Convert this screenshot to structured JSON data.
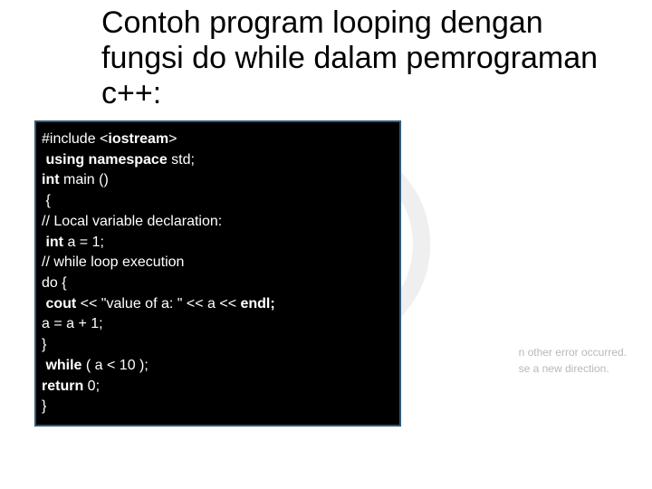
{
  "title": "Contoh program looping dengan fungsi do while dalam pemrograman c++:",
  "bg_hint_1": "n other error occurred.",
  "bg_hint_2": "se a new direction.",
  "code": {
    "l1a": "#include <",
    "l1b": "iostream",
    "l1c": ">",
    "l2a": " using namespace ",
    "l2b": "std;",
    "l3a": "int",
    "l3b": " main ()",
    "l4": " {",
    "l5": "// Local variable declaration:",
    "l6a": " int",
    "l6b": " a = 1;",
    "l7": "// while loop execution",
    "l8": "do {",
    "l9a": " cout",
    "l9b": " << \"value of a: \" << a << ",
    "l9c": "endl;",
    "l10": "a = a + 1;",
    "l11": "}",
    "l12a": " while",
    "l12b": " ( a < 10 );",
    "l13a": "return",
    "l13b": " 0;",
    "l14": "}"
  }
}
